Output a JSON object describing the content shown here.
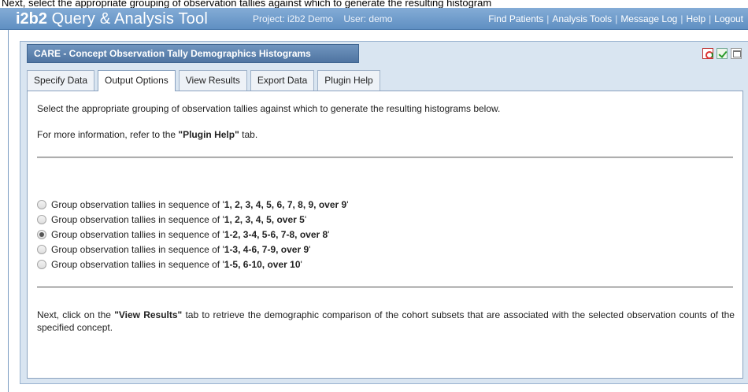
{
  "caption": "Next, select the appropriate grouping of observation tallies against which to generate the resulting histogram",
  "header": {
    "brand_bold": "i2b2",
    "brand_rest": "Query & Analysis Tool",
    "project": "Project: i2b2 Demo",
    "user": "User: demo",
    "nav": [
      "Find Patients",
      "Analysis Tools",
      "Message Log",
      "Help",
      "Logout"
    ]
  },
  "panel": {
    "title": "CARE - Concept Observation Tally Demographics Histograms",
    "icons": [
      "refresh-icon",
      "check-icon",
      "window-icon"
    ],
    "tabs": [
      "Specify Data",
      "Output Options",
      "View Results",
      "Export Data",
      "Plugin Help"
    ],
    "active_tab": "Output Options"
  },
  "content": {
    "intro": "Select the appropriate grouping of observation tallies against which to generate the resulting histograms below.",
    "more_info_prefix": "For more information, refer to the ",
    "more_info_link": "\"Plugin Help\"",
    "more_info_suffix": " tab.",
    "option_prefix": "Group observation tallies in sequence of '",
    "option_suffix": "'",
    "options": [
      {
        "value": "1, 2, 3, 4, 5, 6, 7, 8, 9, over 9",
        "checked": false
      },
      {
        "value": "1, 2, 3, 4, 5, over 5",
        "checked": false
      },
      {
        "value": "1-2, 3-4, 5-6, 7-8, over 8",
        "checked": true
      },
      {
        "value": "1-3, 4-6, 7-9, over 9",
        "checked": false
      },
      {
        "value": "1-5, 6-10, over 10",
        "checked": false
      }
    ],
    "next_prefix": "Next, click on the ",
    "next_link": "\"View Results\"",
    "next_suffix": " tab to retrieve the demographic comparison of the cohort subsets that are associated with the selected observation counts of the specified concept."
  }
}
